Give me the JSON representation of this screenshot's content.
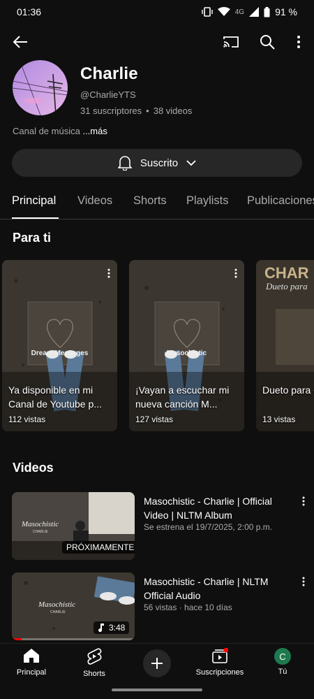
{
  "status_bar": {
    "time": "01:36",
    "network": "4G",
    "battery": "91 %"
  },
  "channel": {
    "name": "Charlie",
    "handle": "@CharlieYTS",
    "subscribers": "31 suscriptores",
    "separator": "•",
    "videos_count": "38 videos",
    "description": "Canal de música",
    "more": "...más"
  },
  "subscribe_button": {
    "label": "Suscrito"
  },
  "tabs": [
    {
      "label": "Principal",
      "active": true
    },
    {
      "label": "Videos"
    },
    {
      "label": "Shorts"
    },
    {
      "label": "Playlists"
    },
    {
      "label": "Publicaciones"
    }
  ],
  "for_you": {
    "title": "Para ti",
    "shorts": [
      {
        "title": "Ya disponible en mi Canal de Youtube p...",
        "views": "112 vistas",
        "art_label": "Dream Messages"
      },
      {
        "title": "¡Vayan a escuchar mi nueva canción M...",
        "views": "127 vistas",
        "art_label": "Masochistic"
      },
      {
        "title": "Dueto para Charlie | So...",
        "views": "13 vistas",
        "art_label": "Dueto para"
      }
    ]
  },
  "videos_section": {
    "title": "Videos",
    "items": [
      {
        "title": "Masochistic - Charlie | Official Video | NLTM Album",
        "meta": "Se estrena el 19/7/2025, 2:00 p.m.",
        "badge": "PRÓXIMAMENTE",
        "thumb_text": "Masochistic",
        "thumb_sub": "CHARLIE"
      },
      {
        "title": "Masochistic - Charlie | NLTM Official Audio",
        "meta": "56 vistas · hace 10 días",
        "badge": "3:48",
        "thumb_text": "Masochistic",
        "thumb_sub": "CHARLIE",
        "progress": 0.08
      }
    ]
  },
  "bottom_nav": {
    "home": "Principal",
    "shorts": "Shorts",
    "subscriptions": "Suscripciones",
    "you": "Tú",
    "you_initial": "C"
  },
  "colors": {
    "background": "#0f0f0f",
    "accent_red": "#ff0000",
    "avatar_green": "#1e7a4e"
  }
}
